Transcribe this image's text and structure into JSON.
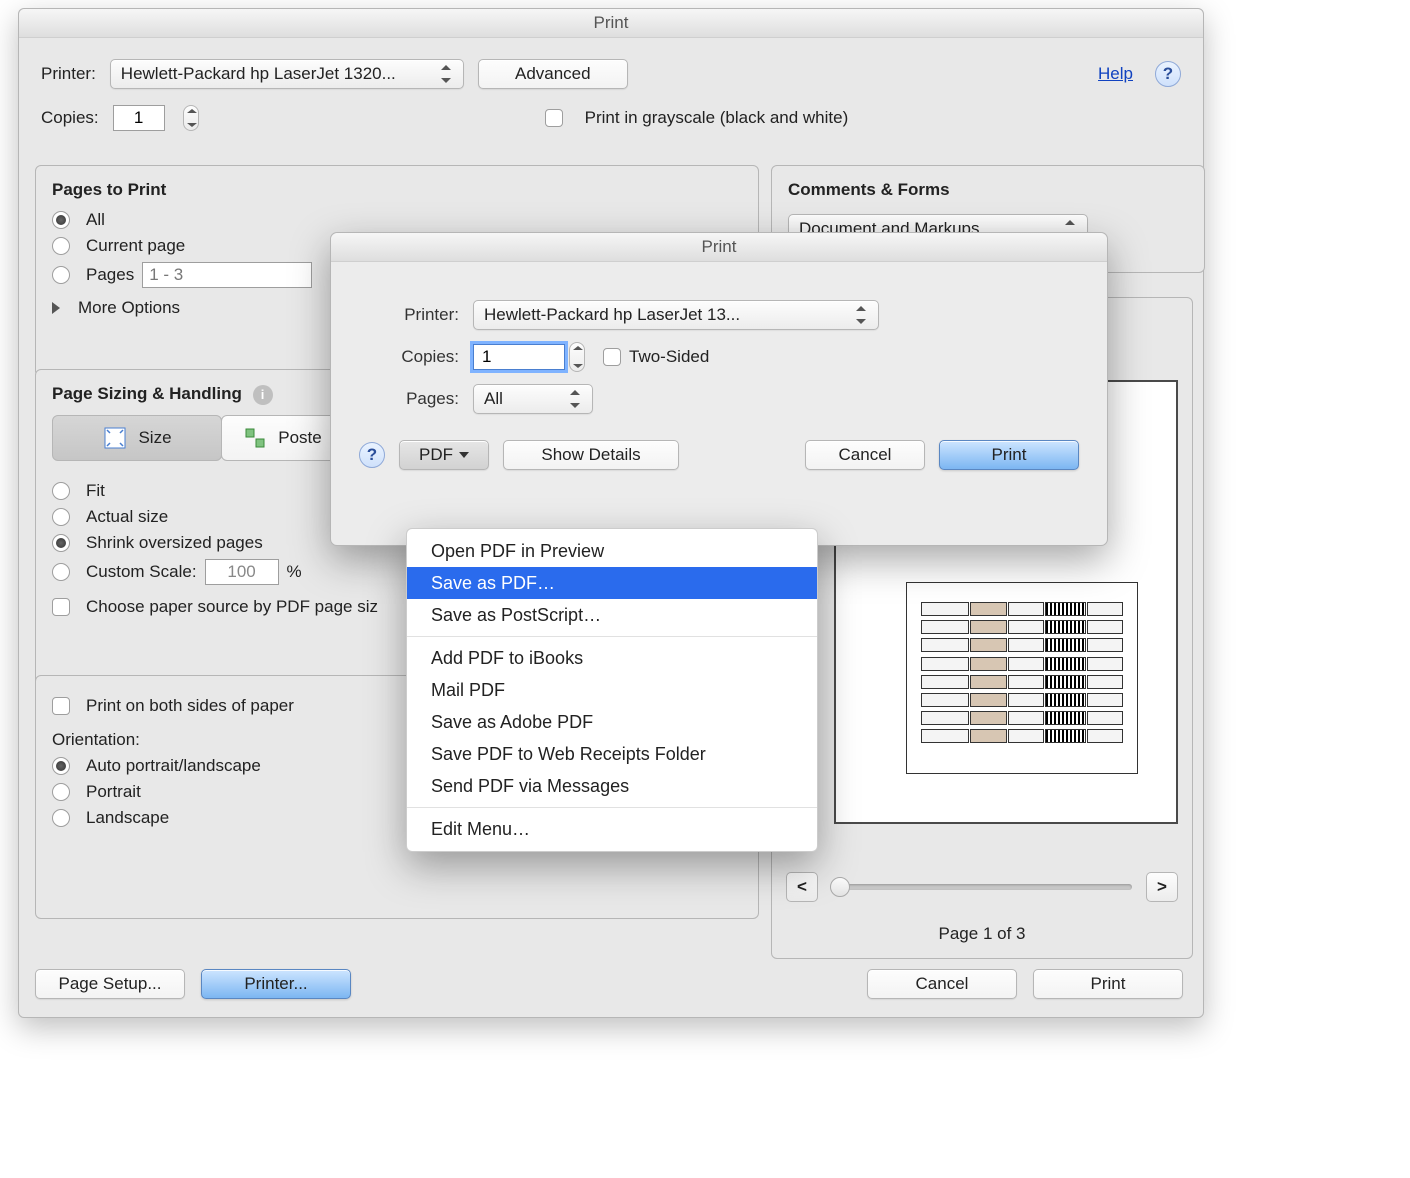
{
  "window": {
    "title": "Print",
    "help_link": "Help"
  },
  "fields": {
    "printer_label": "Printer:",
    "printer_value": "Hewlett-Packard hp LaserJet 1320...",
    "advanced": "Advanced",
    "copies_label": "Copies:",
    "copies_value": "1",
    "grayscale_label": "Print in grayscale (black and white)"
  },
  "pages_group": {
    "title": "Pages to Print",
    "all": "All",
    "current": "Current page",
    "pages": "Pages",
    "pages_value": "1 - 3",
    "more": "More Options"
  },
  "sizing_group": {
    "title": "Page Sizing & Handling",
    "tab_size": "Size",
    "tab_poster": "Poste",
    "fit": "Fit",
    "actual": "Actual size",
    "shrink": "Shrink oversized pages",
    "custom": "Custom Scale:",
    "custom_value": "100",
    "percent": "%",
    "paper_source": "Choose paper source by PDF page siz",
    "both_sides": "Print on both sides of paper",
    "orientation": "Orientation:",
    "auto": "Auto portrait/landscape",
    "portrait": "Portrait",
    "landscape": "Landscape"
  },
  "comments_group": {
    "title": "Comments & Forms",
    "value": "Document and Markups"
  },
  "preview": {
    "page_label": "Page 1 of 3"
  },
  "footer": {
    "page_setup": "Page Setup...",
    "printer": "Printer...",
    "cancel": "Cancel",
    "print": "Print"
  },
  "sheet": {
    "title": "Print",
    "printer_label": "Printer:",
    "printer_value": "Hewlett-Packard hp LaserJet 13...",
    "copies_label": "Copies:",
    "copies_value": "1",
    "two_sided": "Two-Sided",
    "pages_label": "Pages:",
    "pages_value": "All",
    "pdf_btn": "PDF",
    "show_details": "Show Details",
    "cancel": "Cancel",
    "print": "Print"
  },
  "pdf_menu": {
    "open_preview": "Open PDF in Preview",
    "save_pdf": "Save as PDF…",
    "save_ps": "Save as PostScript…",
    "add_ibooks": "Add PDF to iBooks",
    "mail_pdf": "Mail PDF",
    "save_adobe": "Save as Adobe PDF",
    "web_receipts": "Save PDF to Web Receipts Folder",
    "send_messages": "Send PDF via Messages",
    "edit_menu": "Edit Menu…"
  },
  "glyphs": {
    "lt": "<",
    "gt": ">",
    "i": "i",
    "q": "?"
  }
}
